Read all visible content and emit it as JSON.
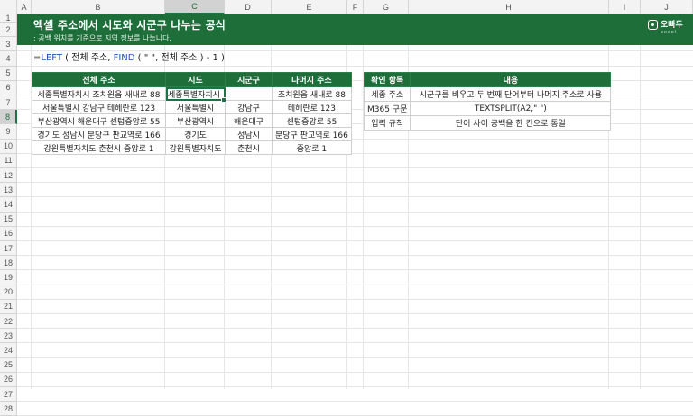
{
  "columns": [
    "A",
    "B",
    "C",
    "D",
    "E",
    "F",
    "G",
    "H",
    "I",
    "J"
  ],
  "rows": [
    "1",
    "2",
    "3",
    "4",
    "5",
    "6",
    "7",
    "8",
    "9",
    "10",
    "11",
    "12",
    "13",
    "14",
    "15",
    "16",
    "17",
    "18",
    "19",
    "20",
    "21",
    "22",
    "23",
    "24",
    "25",
    "26",
    "27",
    "28"
  ],
  "banner": {
    "title": "엑셀 주소에서 시도와 시군구 나누는 공식",
    "subtitle": ": 공백 위치를 기준으로 지역 정보를 나눕니다."
  },
  "logo": {
    "name": "오빠두",
    "tag": "excel"
  },
  "formula": {
    "p1": "=",
    "f1": "LEFT",
    "p2": " ( 전체 주소, ",
    "f2": "FIND",
    "p3": " ( \" \", 전체 주소 ) - 1 )"
  },
  "main_table": {
    "headers": [
      "전체 주소",
      "시도",
      "시군구",
      "나머지 주소"
    ],
    "rows": [
      [
        "세종특별자치시 조치원읍 새내로 88",
        "세종특별자치시",
        "",
        "조치원읍 새내로 88"
      ],
      [
        "서울특별시 강남구 테헤란로 123",
        "서울특별시",
        "강남구",
        "테헤란로 123"
      ],
      [
        "부산광역시 해운대구 센텀중앙로 55",
        "부산광역시",
        "해운대구",
        "센텀중앙로 55"
      ],
      [
        "경기도 성남시 분당구 판교역로 166",
        "경기도",
        "성남시",
        "분당구 판교역로 166"
      ],
      [
        "강원특별자치도 춘천시 중앙로 1",
        "강원특별자치도",
        "춘천시",
        "중앙로 1"
      ]
    ]
  },
  "side_table": {
    "headers": [
      "확인 항목",
      "내용"
    ],
    "rows": [
      [
        "세종 주소",
        "시군구를 비우고 두 번째 단어부터 나머지 주소로 사용"
      ],
      [
        "M365 구문",
        "TEXTSPLIT(A2,\" \")"
      ],
      [
        "입력 규칙",
        "단어 사이 공백을 한 칸으로 통일"
      ]
    ]
  }
}
